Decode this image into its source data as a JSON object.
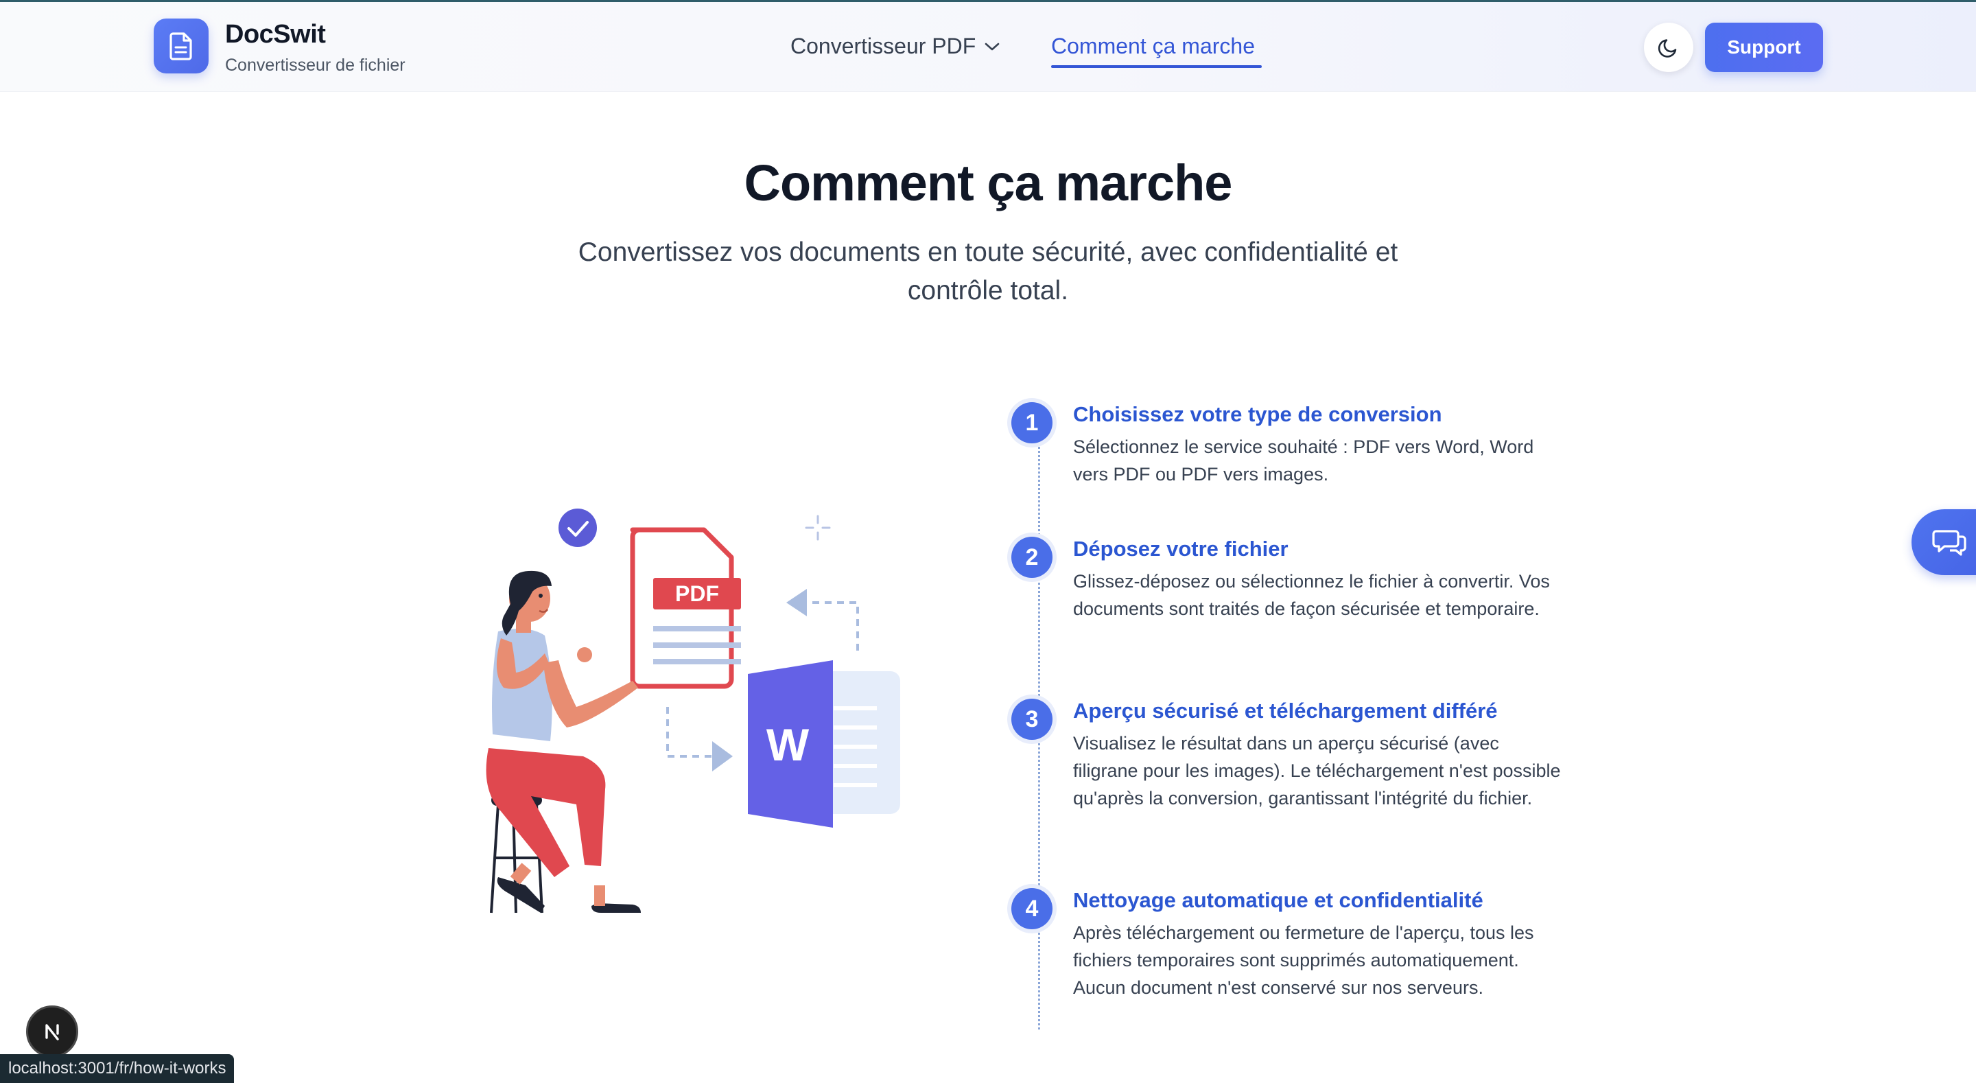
{
  "header": {
    "brand_name": "DocSwit",
    "brand_subtitle": "Convertisseur de fichier",
    "nav": {
      "pdf_converter_label": "Convertisseur PDF",
      "how_it_works_label": "Comment ça marche"
    },
    "theme_toggle_icon": "moon-icon",
    "support_label": "Support"
  },
  "hero": {
    "title": "Comment ça marche",
    "subtitle": "Convertissez vos documents en toute sécurité, avec confidentialité et contrôle total."
  },
  "illustration": {
    "pdf_label": "PDF",
    "word_label": "W"
  },
  "steps": [
    {
      "number": "1",
      "title": "Choisissez votre type de conversion",
      "description": "Sélectionnez le service souhaité : PDF vers Word, Word vers PDF ou PDF vers images."
    },
    {
      "number": "2",
      "title": "Déposez votre fichier",
      "description": "Glissez-déposez ou sélectionnez le fichier à convertir. Vos documents sont traités de façon sécurisée et temporaire."
    },
    {
      "number": "3",
      "title": "Aperçu sécurisé et téléchargement différé",
      "description": "Visualisez le résultat dans un aperçu sécurisé (avec filigrane pour les images). Le téléchargement n'est possible qu'après la conversion, garantissant l'intégrité du fichier."
    },
    {
      "number": "4",
      "title": "Nettoyage automatique et confidentialité",
      "description": "Après téléchargement ou fermeture de l'aperçu, tous les fichiers temporaires sont supprimés automatiquement. Aucun document n'est conservé sur nos serveurs."
    }
  ],
  "widgets": {
    "chat_icon": "chat-bubbles-icon",
    "dev_badge_label": "N"
  },
  "status_bar": {
    "url": "localhost:3001/fr/how-it-works"
  },
  "colors": {
    "accent": "#4a6ee8",
    "link": "#2b56d1",
    "pdf_red": "#e0484f",
    "word_purple": "#6461e6"
  }
}
